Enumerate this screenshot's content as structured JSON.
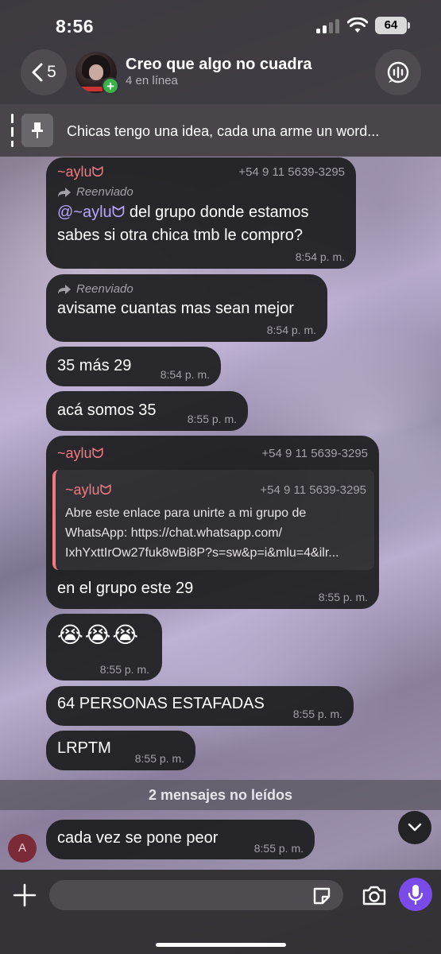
{
  "status_bar": {
    "time": "8:56",
    "battery": "64"
  },
  "header": {
    "back_count": "5",
    "title": "Creo que algo no cuadra",
    "subtitle": "4 en línea"
  },
  "pinned": {
    "text": "Chicas tengo una idea, cada una arme un word..."
  },
  "messages": [
    {
      "sender": "~ayluᗢ",
      "phone": "+54 9 11 5639-3295",
      "forwarded": "Reenviado",
      "mention": "@~ayluᗢ",
      "line1_rest": " del grupo donde estamos",
      "line2": "sabes si otra chica tmb le compro?",
      "time": "8:54 p. m."
    },
    {
      "forwarded": "Reenviado",
      "text": "avisame cuantas mas sean mejor",
      "time": "8:54 p. m."
    },
    {
      "text": "35 más 29",
      "time": "8:54 p. m."
    },
    {
      "text": "acá somos 35",
      "time": "8:55 p. m."
    },
    {
      "sender": "~ayluᗢ",
      "phone": "+54 9 11 5639-3295",
      "quote": {
        "sender": "~ayluᗢ",
        "phone": "+54 9 11 5639-3295",
        "line1": "Abre este enlace para unirte a mi grupo de",
        "line2": "WhatsApp: https://chat.whatsapp.com/",
        "line3": "IxhYxttIrOw27fuk8wBi8P?s=sw&p=i&mlu=4&ilr..."
      },
      "text": "en el grupo este 29",
      "time": "8:55 p. m."
    },
    {
      "text": "😭😭😭",
      "time": "8:55 p. m."
    },
    {
      "text": "64 PERSONAS ESTAFADAS",
      "time": "8:55 p. m."
    },
    {
      "text": "LRPTM",
      "time": "8:55 p. m."
    },
    {
      "text": "cada vez se pone peor",
      "time": "8:55 p. m.",
      "avatar_letter": "A"
    }
  ],
  "unread": "2 mensajes no leídos",
  "input": {
    "placeholder": ""
  },
  "colors": {
    "accent": "#7a4be8",
    "sender": "#f07a82",
    "mention": "#b9a5ff"
  }
}
